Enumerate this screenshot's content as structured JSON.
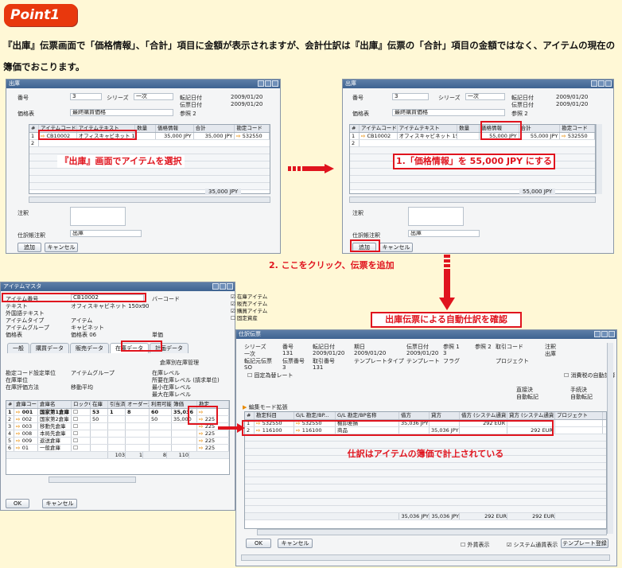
{
  "badge": "Point1",
  "intro": "『出庫』伝票画面で「価格情報」、「合計」項目に金額が表示されますが、会計仕訳は『出庫』伝票の「合計」項目の金額ではなく、アイテムの現在の簿価でおこります。",
  "left_doc": {
    "title": "出庫",
    "number_label": "番号",
    "number_value": "3",
    "series_label": "シリーズ",
    "series_value": "一次",
    "posting_date_label": "転記日付",
    "posting_date": "2009/01/20",
    "doc_date_label": "伝票日付",
    "doc_date": "2009/01/20",
    "ref2_label": "参照 2",
    "pricelist_label": "価格表",
    "pricelist_value": "最終購買価格",
    "grid_headers": [
      "#",
      "アイテムコード",
      "アイテムテキスト",
      "数量",
      "価格情報",
      "合計",
      "勘定コード"
    ],
    "row1": [
      "1",
      "CB10002",
      "オフィスキャビネット 150x90",
      "",
      "35,000 JPY",
      "35,000 JPY",
      "532550"
    ],
    "row2_num": "2",
    "total": "35,000 JPY",
    "remarks_label": "注釈",
    "journal_label": "仕訳帳注釈",
    "journal_value": "出庫",
    "add_button": "追加",
    "cancel_button": "キャンセル",
    "callout": "『出庫』画面でアイテムを選択"
  },
  "right_doc": {
    "title": "出庫",
    "number_label": "番号",
    "number_value": "3",
    "series_label": "シリーズ",
    "series_value": "一次",
    "posting_date_label": "転記日付",
    "posting_date": "2009/01/20",
    "doc_date_label": "伝票日付",
    "doc_date": "2009/01/20",
    "ref2_label": "参照 2",
    "pricelist_label": "価格表",
    "pricelist_value": "最終購買価格",
    "grid_headers": [
      "#",
      "アイテムコード",
      "アイテムテキスト",
      "数量",
      "価格情報",
      "合計",
      "勘定コード"
    ],
    "row1": [
      "1",
      "CB10002",
      "オフィスキャビネット 150x90",
      "",
      "55,000 JPY",
      "55,000 JPY",
      "532550"
    ],
    "row2_num": "2",
    "total": "55,000 JPY",
    "remarks_label": "注釈",
    "journal_label": "仕訳帳注釈",
    "journal_value": "出庫",
    "add_button": "追加",
    "cancel_button": "キャンセル",
    "callout": "1.「価格情報」を 55,000 JPY にする"
  },
  "step2": "2. ここをクリック、伝票を追加",
  "step3": "出庫伝票による自動仕訳を確認",
  "item_master": {
    "title": "アイテムマスタ",
    "item_no_label": "アイテム番号",
    "item_no_value": "CB10002",
    "barcode_label": "バーコード",
    "text_label": "テキスト",
    "text_value": "オフィスキャビネット 150x90",
    "foreign_label": "外国語テキスト",
    "type_label": "アイテムタイプ",
    "type_value": "アイテム",
    "group_label": "アイテムグループ",
    "group_value": "キャビネット",
    "pricelist_label": "価格表",
    "pricelist_value": "価格表 06",
    "unit_price_label": "単価",
    "checks": [
      "在庫アイテム",
      "販売アイテム",
      "購買アイテム",
      "固定資産"
    ],
    "tabs": [
      "一般",
      "購買データ",
      "販売データ",
      "在庫データ",
      "計画データ",
      "プロパティ"
    ],
    "manage_label": "倉庫別在庫管理",
    "gl_label": "勘定コード設定単位",
    "gl_value": "アイテムグループ",
    "inv_unit_label": "在庫単位",
    "valuation_label": "在庫評価方法",
    "valuation_value": "移動平均",
    "level_labels": [
      "在庫レベル",
      "所要在庫レベル (請求単位)",
      "最小在庫レベル",
      "最大在庫レベル"
    ],
    "grid_headers": [
      "#",
      "倉庫コード",
      "倉庫名",
      "ロック中",
      "在庫",
      "引当済",
      "オーダー済",
      "利用可能",
      "簿価",
      "勘定"
    ],
    "rows": [
      {
        "no": "1",
        "code": "001",
        "name": "国家第1倉庫",
        "stock": "53",
        "committed": "1",
        "ordered": "8",
        "avail": "60",
        "cost": "35,036",
        "acct": ""
      },
      {
        "no": "2",
        "code": "002",
        "name": "国家第2倉庫",
        "stock": "50",
        "committed": "",
        "ordered": "",
        "avail": "50",
        "cost": "35,000",
        "acct": "225"
      },
      {
        "no": "3",
        "code": "003",
        "name": "移動先倉庫",
        "stock": "",
        "committed": "",
        "ordered": "",
        "avail": "",
        "cost": "",
        "acct": "225"
      },
      {
        "no": "4",
        "code": "008",
        "name": "本局先倉庫",
        "stock": "",
        "committed": "",
        "ordered": "",
        "avail": "",
        "cost": "",
        "acct": "225"
      },
      {
        "no": "5",
        "code": "009",
        "name": "返送倉庫",
        "stock": "",
        "committed": "",
        "ordered": "",
        "avail": "",
        "cost": "",
        "acct": "225"
      },
      {
        "no": "6",
        "code": "01",
        "name": "一般倉庫",
        "stock": "",
        "committed": "",
        "ordered": "",
        "avail": "",
        "cost": "",
        "acct": "225"
      }
    ],
    "totals": [
      "103",
      "1",
      "8",
      "110"
    ],
    "ok_button": "OK",
    "cancel_button": "キャンセル"
  },
  "journal": {
    "title": "仕訳伝票",
    "hdr_labels": [
      "シリーズ",
      "番号",
      "転記日付",
      "期日",
      "伝票日付",
      "参照 1",
      "参照 2",
      "取引コード",
      "注釈"
    ],
    "hdr_values": [
      "一次",
      "131",
      "2009/01/20",
      "2009/01/20",
      "2009/01/20",
      "3",
      "",
      "",
      "出庫"
    ],
    "hdr2_labels": [
      "転記元伝票",
      "伝票番号",
      "取引番号",
      "テンプレートタイプ",
      "テンプレート",
      "フラグ",
      "プロジェクト"
    ],
    "hdr2_values": [
      "SO",
      "3",
      "131"
    ],
    "fx_label": "固定為替レート",
    "auto_tax_label": "消費税の自動計算",
    "ind_label1": "直接決",
    "ind_label2": "手続決",
    "ind_value1": "自動転記",
    "ind_value2": "自動転記",
    "mode_label": "編集モード拡張",
    "grid_headers": [
      "#",
      "勘定科目",
      "G/L 勘定/BP...",
      "G/L 勘定/BP名称",
      "借方",
      "貸方",
      "借方 (システム通貨)",
      "貸方 (システム通貨)",
      "プロジェクト"
    ],
    "rows": [
      {
        "no": "1",
        "acct": "532550",
        "gl": "532550",
        "name": "棚卸差損",
        "debit": "35,036 JPY",
        "credit": "",
        "debit_sc": "292 EUR",
        "credit_sc": ""
      },
      {
        "no": "2",
        "acct": "116100",
        "gl": "116100",
        "name": "商品",
        "debit": "",
        "credit": "35,036 JPY",
        "debit_sc": "",
        "credit_sc": "292 EUR"
      }
    ],
    "totals": [
      "35,036 JPY",
      "35,036 JPY",
      "292 EUR",
      "292 EUR"
    ],
    "ok_button": "OK",
    "cancel_button": "キャンセル",
    "fc_label": "外貨表示",
    "sc_label": "システム通貨表示",
    "template_button": "テンプレート登録",
    "callout": "仕訳はアイテムの簿価で計上されている"
  },
  "colors": {
    "accent_red": "#e0141e",
    "badge": "#e8380d",
    "title_blue": "#3e6391",
    "background": "#fff8d6"
  }
}
